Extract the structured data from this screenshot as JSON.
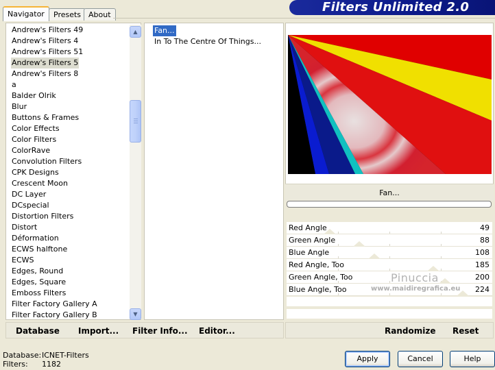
{
  "tabs": [
    "Navigator",
    "Presets",
    "About"
  ],
  "banner_title": "Filters Unlimited 2.0",
  "categories": [
    "Andrew's Filters 49",
    "Andrew's Filters 4",
    "Andrew's Filters 51",
    "Andrew's Filters 5",
    "Andrew's Filters 8",
    "a",
    "Balder Olrik",
    "Blur",
    "Buttons & Frames",
    "Color Effects",
    "Color Filters",
    "ColorRave",
    "Convolution Filters",
    "CPK Designs",
    "Crescent Moon",
    "DC Layer",
    "DCspecial",
    "Distortion Filters",
    "Distort",
    "Déformation",
    "ECWS halftone",
    "ECWS",
    "Edges, Round",
    "Edges, Square",
    "Emboss Filters",
    "Filter Factory Gallery A",
    "Filter Factory Gallery B"
  ],
  "selected_category": "Andrew's Filters 5",
  "filters": [
    "Fan...",
    "In To The Centre Of Things..."
  ],
  "selected_filter": "Fan...",
  "filter_name": "Fan...",
  "params": [
    {
      "label": "Red Angle",
      "value": "49",
      "level": 49
    },
    {
      "label": "Green Angle",
      "value": "88",
      "level": 88
    },
    {
      "label": "Blue Angle",
      "value": "108",
      "level": 108
    },
    {
      "label": "Red Angle, Too",
      "value": "185",
      "level": 185
    },
    {
      "label": "Green Angle, Too",
      "value": "200",
      "level": 200
    },
    {
      "label": "Blue Angle, Too",
      "value": "224",
      "level": 224
    }
  ],
  "watermark": {
    "name": "Pinuccia",
    "site": "www.maidiregrafica.eu"
  },
  "commands": {
    "database": "Database",
    "import": "Import...",
    "filter_info": "Filter Info...",
    "editor": "Editor...",
    "randomize": "Randomize",
    "reset": "Reset"
  },
  "status": {
    "database_label": "Database:",
    "database_value": "ICNET-Filters",
    "filters_label": "Filters:",
    "filters_value": "1182"
  },
  "buttons": {
    "apply": "Apply",
    "cancel": "Cancel",
    "help": "Help"
  },
  "colors": {
    "selection": "#316ac5",
    "banner": "#0c1a8a",
    "accent_tab": "#f6b436"
  }
}
